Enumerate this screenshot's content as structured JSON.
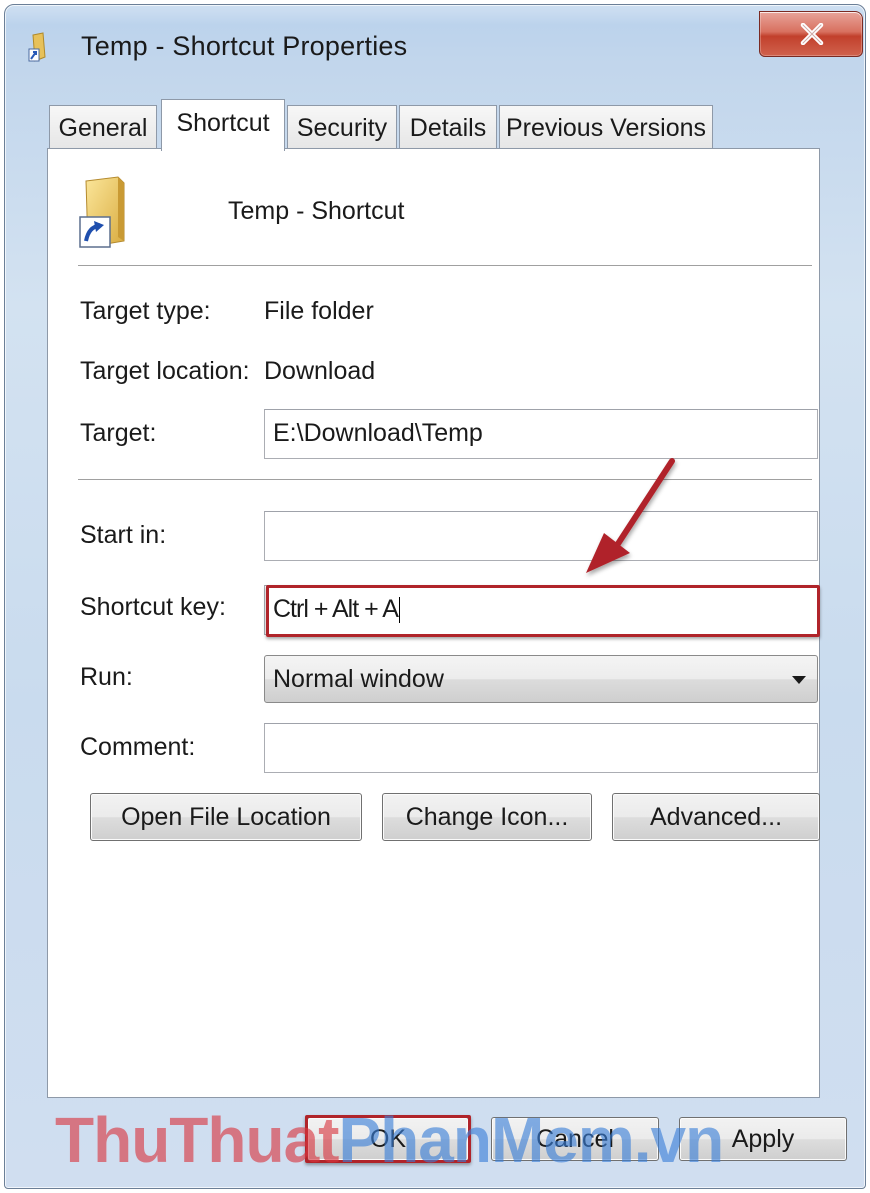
{
  "window": {
    "title": "Temp - Shortcut Properties",
    "close_glyph": "X"
  },
  "tabs": [
    {
      "label": "General",
      "active": false
    },
    {
      "label": "Shortcut",
      "active": true
    },
    {
      "label": "Security",
      "active": false
    },
    {
      "label": "Details",
      "active": false
    },
    {
      "label": "Previous Versions",
      "active": false
    }
  ],
  "header": {
    "name": "Temp - Shortcut",
    "icon": "folder-shortcut-icon"
  },
  "fields": {
    "target_type_label": "Target type:",
    "target_type_value": "File folder",
    "target_location_label": "Target location:",
    "target_location_value": "Download",
    "target_label": "Target:",
    "target_value": "E:\\Download\\Temp",
    "start_in_label": "Start in:",
    "start_in_value": "",
    "shortcut_key_label": "Shortcut key:",
    "shortcut_key_value": "Ctrl + Alt + A",
    "run_label": "Run:",
    "run_value": "Normal window",
    "comment_label": "Comment:",
    "comment_value": ""
  },
  "buttons": {
    "open_file_location": "Open File Location",
    "change_icon": "Change Icon...",
    "advanced": "Advanced...",
    "ok": "OK",
    "cancel": "Cancel",
    "apply": "Apply"
  },
  "watermark": {
    "part1": "ThuThuat",
    "part2": "PhanMem",
    "part3": ".vn"
  },
  "colors": {
    "highlight": "#b0242a",
    "watermark_red": "#d9363f",
    "watermark_blue": "#3a7fd8"
  }
}
